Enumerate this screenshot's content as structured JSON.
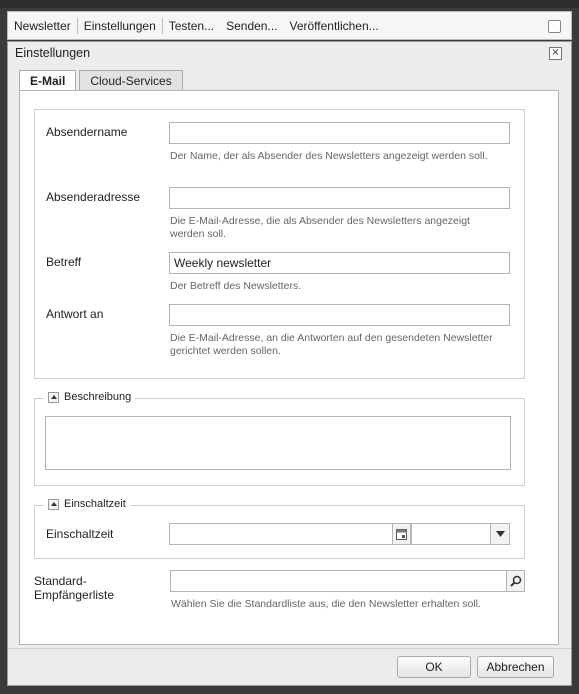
{
  "toolbar": {
    "items": [
      "Newsletter",
      "Einstellungen",
      "Testen...",
      "Senden...",
      "Veröffentlichen..."
    ]
  },
  "dialog": {
    "title": "Einstellungen",
    "close_icon": "close-icon",
    "tabs": [
      {
        "label": "E-Mail",
        "active": true
      },
      {
        "label": "Cloud-Services",
        "active": false
      }
    ],
    "fields": {
      "sender_name": {
        "label": "Absendername",
        "value": "",
        "hint": "Der Name, der als Absender des Newsletters angezeigt werden soll."
      },
      "sender_address": {
        "label": "Absenderadresse",
        "value": "",
        "hint": "Die E-Mail-Adresse, die als Absender des Newsletters angezeigt werden soll."
      },
      "subject": {
        "label": "Betreff",
        "value": "Weekly newsletter",
        "hint": "Der Betreff des Newsletters."
      },
      "reply_to": {
        "label": "Antwort an",
        "value": "",
        "hint": "Die E-Mail-Adresse, an die Antworten auf den gesendeten Newsletter gerichtet werden sollen."
      }
    },
    "description_section": {
      "legend": "Beschreibung",
      "value": ""
    },
    "onset_section": {
      "legend": "Einschaltzeit",
      "label": "Einschaltzeit",
      "date_value": "",
      "time_value": ""
    },
    "default_list": {
      "label_line1": "Standard-",
      "label_line2": "Empfängerliste",
      "value": "",
      "hint": "Wählen Sie die Standardliste aus, die den Newsletter erhalten soll."
    },
    "buttons": {
      "ok": "OK",
      "cancel": "Abbrechen"
    }
  }
}
